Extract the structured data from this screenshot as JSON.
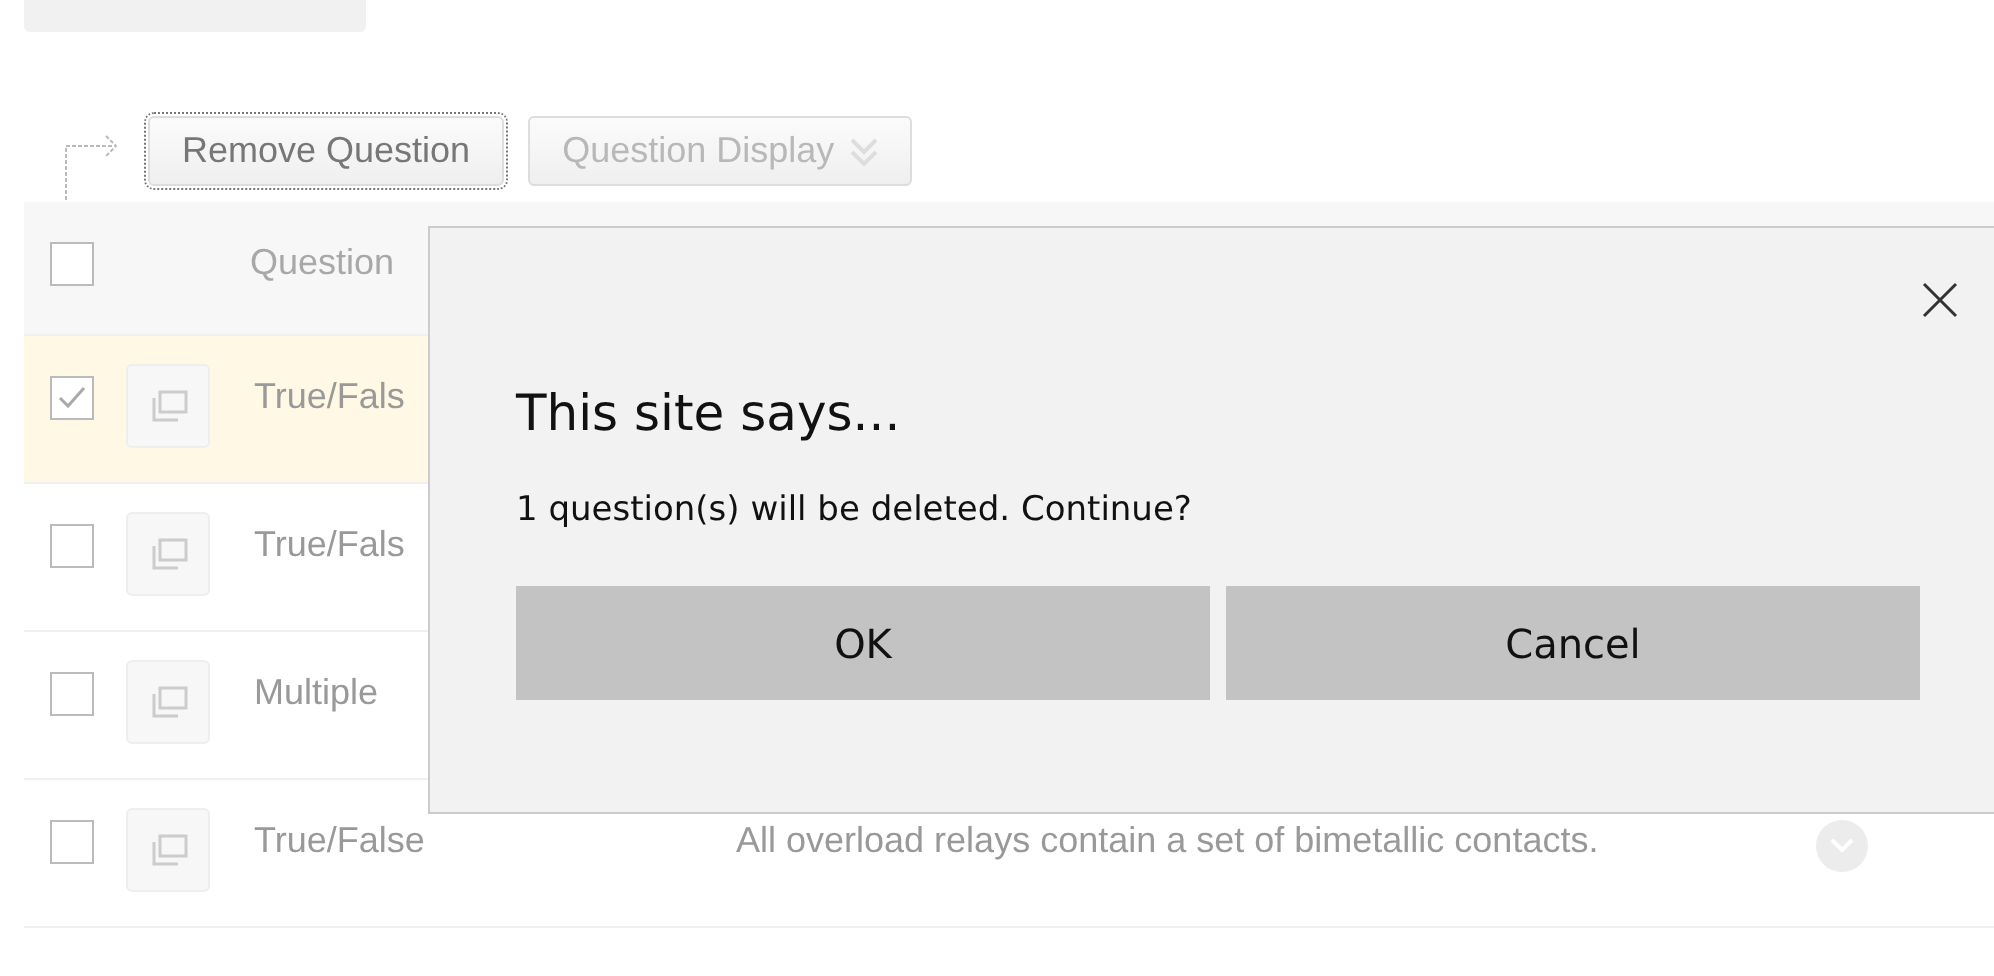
{
  "toolbar": {
    "buttons": [
      {
        "label": "Remove Question",
        "kind": "focused"
      },
      {
        "label": "Question Display",
        "kind": "dropdown"
      }
    ]
  },
  "table": {
    "header": {
      "checked": false,
      "type": "Question"
    },
    "rows": [
      {
        "type": "True/Fals",
        "question": "",
        "checked": true,
        "selected": true
      },
      {
        "type": "True/Fals",
        "question": "",
        "checked": false,
        "selected": false
      },
      {
        "type": "Multiple",
        "question": "",
        "checked": false,
        "selected": false
      },
      {
        "type": "True/False",
        "question": "All overload relays contain a set of bimetallic contacts.",
        "checked": false,
        "selected": false
      }
    ]
  },
  "dialog": {
    "title": "This site says...",
    "message": "1 question(s) will be deleted. Continue?",
    "buttons": [
      "OK",
      "Cancel"
    ]
  }
}
